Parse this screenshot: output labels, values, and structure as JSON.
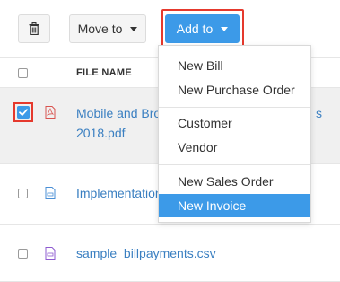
{
  "toolbar": {
    "delete_icon": "trash-icon",
    "move_label": "Move to",
    "add_label": "Add to"
  },
  "table": {
    "column_file_name": "FILE NAME",
    "rows": [
      {
        "name_line1": "Mobile and Bro",
        "name_line2": "2018.pdf",
        "name_tail": "s",
        "icon": "pdf-file-icon",
        "checked": true
      },
      {
        "name": "Implementation",
        "icon": "document-file-icon",
        "checked": false
      },
      {
        "name": "sample_billpayments.csv",
        "icon": "csv-file-icon",
        "checked": false
      }
    ]
  },
  "menu": {
    "items": [
      {
        "label": "New Bill"
      },
      {
        "label": "New Purchase Order"
      },
      {
        "label": "Customer"
      },
      {
        "label": "Vendor"
      },
      {
        "label": "New Sales Order"
      },
      {
        "label": "New Invoice"
      }
    ]
  },
  "colors": {
    "accent": "#3c9ae8",
    "highlight_outline": "#e5392d",
    "link": "#3a7fc1"
  }
}
